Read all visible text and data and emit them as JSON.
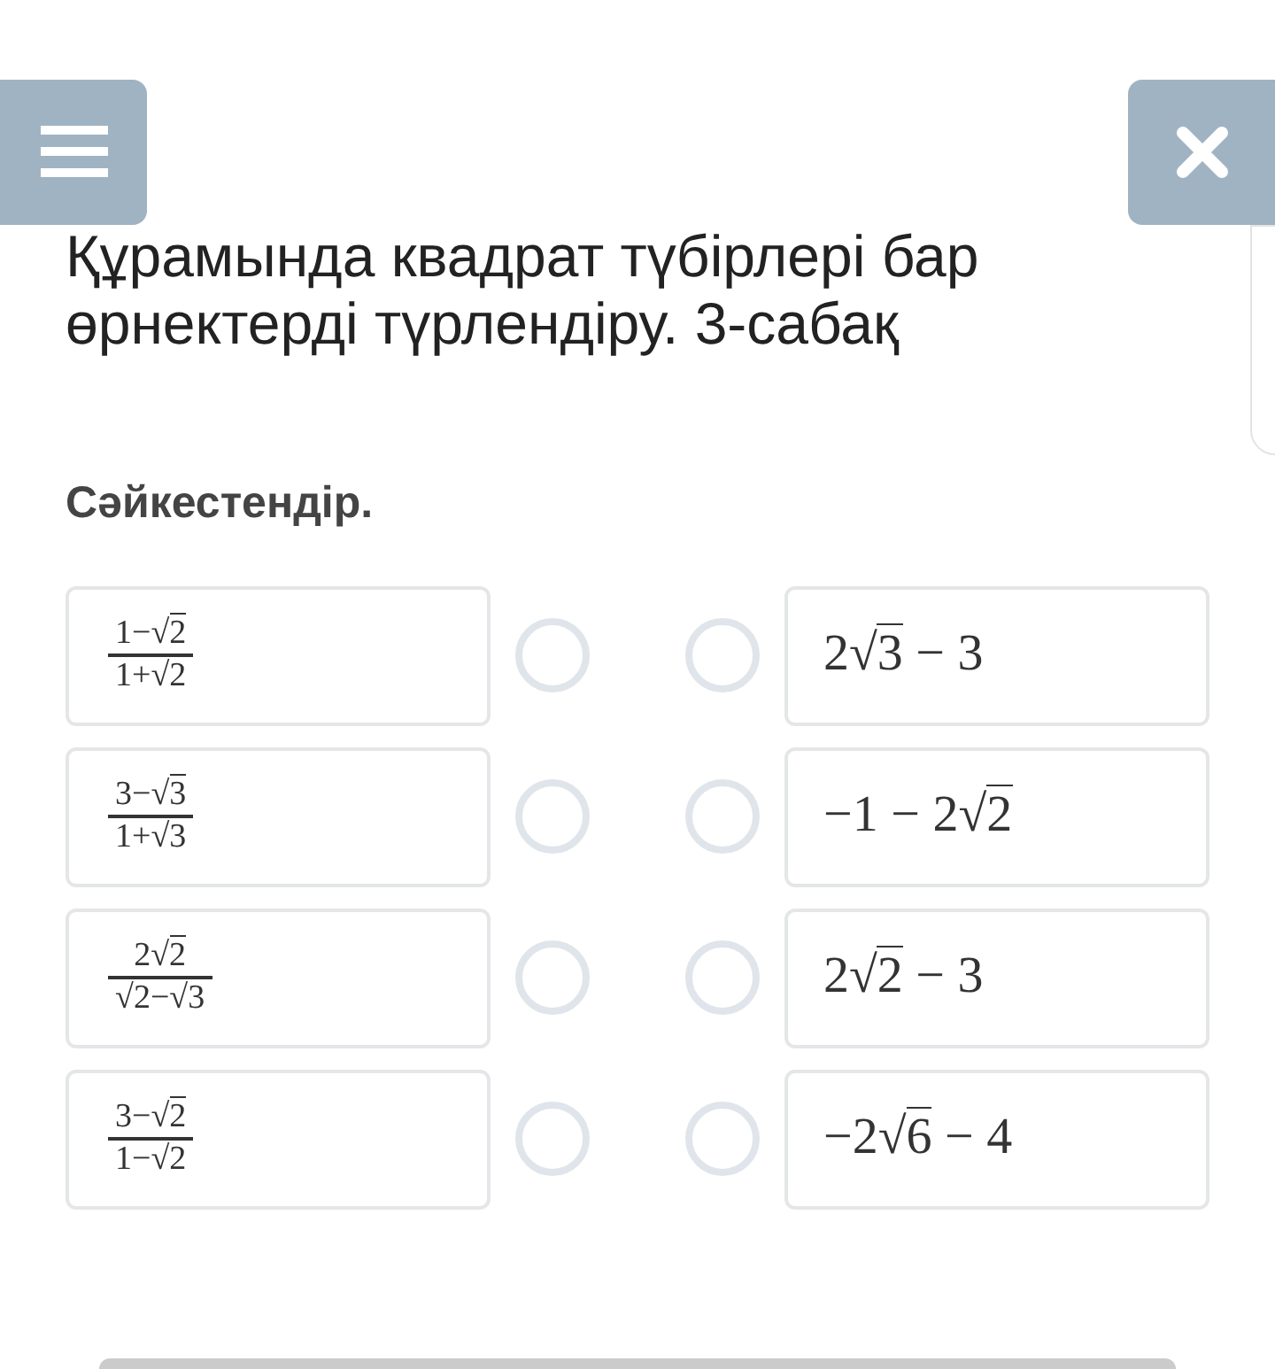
{
  "title": "Құрамында квадрат түбірлері бар өрнектерді түрлендіру. 3-сабақ",
  "instruction": "Сәйкестендір.",
  "left_items": [
    {
      "numerator": "1−√2",
      "denominator": "1+√2",
      "selected": false
    },
    {
      "numerator": "3−√3",
      "denominator": "1+√3",
      "selected": false
    },
    {
      "numerator": "2√2",
      "denominator": "√2−√3",
      "selected": false
    },
    {
      "numerator": "3−√2",
      "denominator": "1−√2",
      "selected": false
    }
  ],
  "right_items": [
    {
      "text": "2√3 − 3",
      "selected": false
    },
    {
      "text": "−1 − 2√2",
      "selected": false
    },
    {
      "text": "2√2 − 3",
      "selected": false
    },
    {
      "text": "−2√6 − 4",
      "selected": false
    }
  ]
}
